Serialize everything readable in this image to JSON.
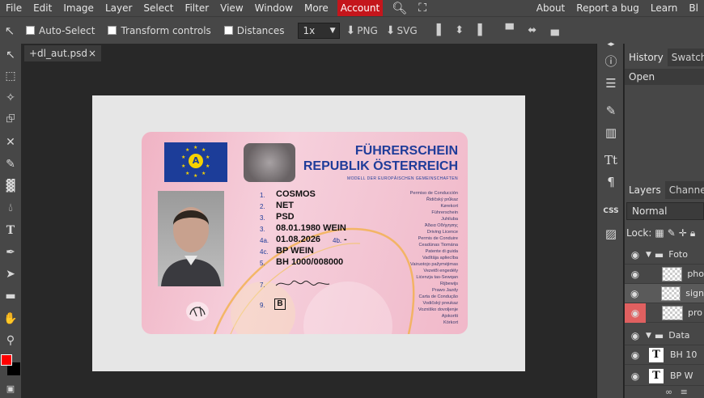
{
  "menubar": {
    "items": [
      "File",
      "Edit",
      "Image",
      "Layer",
      "Select",
      "Filter",
      "View",
      "Window",
      "More"
    ],
    "account": "Account",
    "right_items": [
      "About",
      "Report a bug",
      "Learn",
      "Bl"
    ]
  },
  "toolbar": {
    "auto_select": "Auto-Select",
    "transform_controls": "Transform controls",
    "distances": "Distances",
    "zoom_select": "1x",
    "png_label": "PNG",
    "svg_label": "SVG"
  },
  "document": {
    "tab_title": "+dl_aut.psd",
    "close": "×"
  },
  "card": {
    "flag_letter": "A",
    "title_line1": "FÜHRERSCHEIN",
    "title_line2": "REPUBLIK ÖSTERREICH",
    "subtitle": "MODELL DER EUROPÄISCHEN GEMEINSCHAFTEN",
    "fields": [
      {
        "num": "1.",
        "value": "COSMOS"
      },
      {
        "num": "2.",
        "value": "NET"
      },
      {
        "num": "3.",
        "value": "PSD"
      },
      {
        "num": "3.",
        "value": "08.01.1980 WEIN"
      },
      {
        "num": "4a.",
        "value": "01.08.2026"
      },
      {
        "num": "4c.",
        "value": "BP WEIN"
      },
      {
        "num": "5.",
        "value": "BH 1000/008000"
      }
    ],
    "field_4b": "4b.",
    "field_4b_value": "-",
    "sig_num": "7.",
    "cat_num": "9.",
    "cat_value": "B",
    "labels": [
      "Permiso de Conducción",
      "Řidičský průkaz",
      "Kørekort",
      "Führerschein",
      "Juhiluba",
      "Άδεια Οδήγησης",
      "Driving Licence",
      "Permis de Conduire",
      "Ceadúnas Tiomána",
      "Patente di guida",
      "Vadītāja apliecība",
      "Vairuotojo pažymėjimas",
      "Vezetői engedély",
      "Liċenzja tas-Sewqan",
      "Rijbewijs",
      "Prawo Jazdy",
      "Carta de Condução",
      "Vodičský preukaz",
      "Vozniško dovoljenje",
      "Ajokortti",
      "Körkort"
    ]
  },
  "panels": {
    "history_tab": "History",
    "swatches_tab": "Swatch",
    "history_open": "Open",
    "layers_tab": "Layers",
    "channels_tab": "Channe",
    "blend_mode": "Normal",
    "lock_label": "Lock:",
    "layers": [
      {
        "type": "folder",
        "name": "Foto"
      },
      {
        "type": "image",
        "name": "pho"
      },
      {
        "type": "image",
        "name": "sign"
      },
      {
        "type": "image",
        "name": "pro"
      },
      {
        "type": "folder",
        "name": "Data"
      },
      {
        "type": "text",
        "name": "BH 10"
      },
      {
        "type": "text",
        "name": "BP W"
      }
    ]
  },
  "colors": {
    "foreground": "#ff0000",
    "background": "#000000",
    "account_bg": "#c4161c",
    "eu_blue": "#1c3d99",
    "card_title_blue": "#1f3c99"
  }
}
